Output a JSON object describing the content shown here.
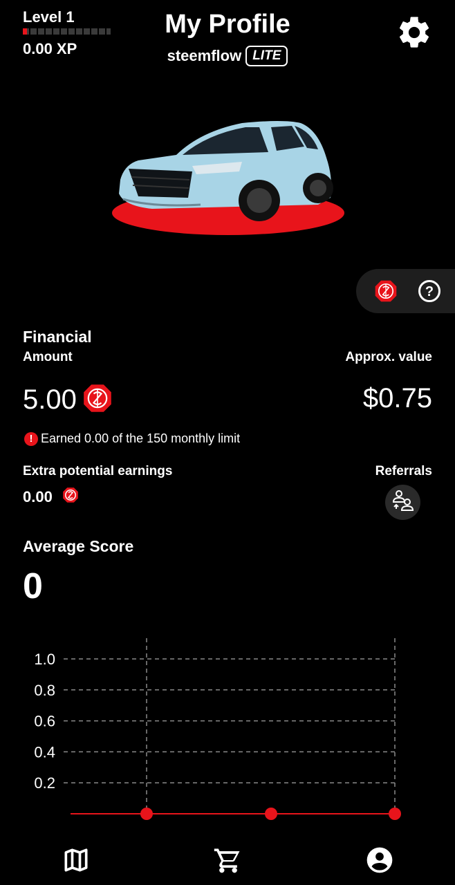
{
  "header": {
    "level": "Level 1",
    "xp": "0.00 XP",
    "xp_progress": 0.05,
    "title": "My Profile",
    "brand": "steemflow",
    "badge": "LITE"
  },
  "icons": {
    "settings": "gear-icon",
    "token": "steemflow-token-icon",
    "help": "help-icon",
    "alert": "alert-icon",
    "referrals": "referrals-icon",
    "map": "map-icon",
    "cart": "cart-icon",
    "profile": "profile-icon"
  },
  "financial": {
    "title": "Financial",
    "amount_label": "Amount",
    "approx_label": "Approx. value",
    "amount": "5.00",
    "approx": "$0.75",
    "limit_text": "Earned 0.00 of the 150 monthly limit",
    "extra_label": "Extra potential earnings",
    "extra_value": "0.00",
    "referrals_label": "Referrals"
  },
  "score": {
    "label": "Average Score",
    "value": "0"
  },
  "colors": {
    "accent": "#e8141b",
    "background": "#000000",
    "car": "#a8d4e6"
  },
  "chart_data": {
    "type": "line",
    "y_ticks": [
      "1.0",
      "0.8",
      "0.6",
      "0.4",
      "0.2"
    ],
    "ylim": [
      0,
      1.0
    ],
    "series": [
      {
        "values": [
          0,
          0,
          0
        ]
      }
    ],
    "grid": true
  }
}
